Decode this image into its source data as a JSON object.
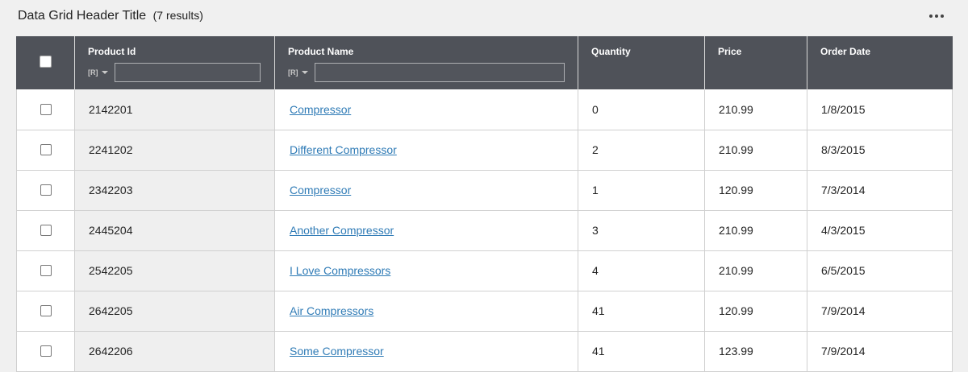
{
  "header": {
    "title": "Data Grid Header Title",
    "results": "(7 results)"
  },
  "columns": {
    "product_id": "Product Id",
    "product_name": "Product Name",
    "quantity": "Quantity",
    "price": "Price",
    "order_date": "Order Date"
  },
  "filters": {
    "product_id": {
      "type_icon": "[R]",
      "value": ""
    },
    "product_name": {
      "type_icon": "[R]",
      "value": ""
    }
  },
  "rows": [
    {
      "id": "2142201",
      "name": "Compressor",
      "quantity": "0",
      "price": "210.99",
      "date": "1/8/2015"
    },
    {
      "id": "2241202",
      "name": "Different Compressor",
      "quantity": "2",
      "price": "210.99",
      "date": "8/3/2015"
    },
    {
      "id": "2342203",
      "name": "Compressor",
      "quantity": "1",
      "price": "120.99",
      "date": "7/3/2014"
    },
    {
      "id": "2445204",
      "name": "Another Compressor",
      "quantity": "3",
      "price": "210.99",
      "date": "4/3/2015"
    },
    {
      "id": "2542205",
      "name": "I Love Compressors",
      "quantity": "4",
      "price": "210.99",
      "date": "6/5/2015"
    },
    {
      "id": "2642205",
      "name": "Air Compressors",
      "quantity": "41",
      "price": "120.99",
      "date": "7/9/2014"
    },
    {
      "id": "2642206",
      "name": "Some Compressor",
      "quantity": "41",
      "price": "123.99",
      "date": "7/9/2014"
    }
  ],
  "icons": {
    "more": "more-horizontal-icon",
    "filter_type": "regex-filter-icon",
    "caret": "caret-down-icon"
  },
  "colors": {
    "header_bg": "#4f5259",
    "link": "#2f7bb6",
    "id_column_bg": "#efefef",
    "page_bg": "#f0f0f0"
  }
}
